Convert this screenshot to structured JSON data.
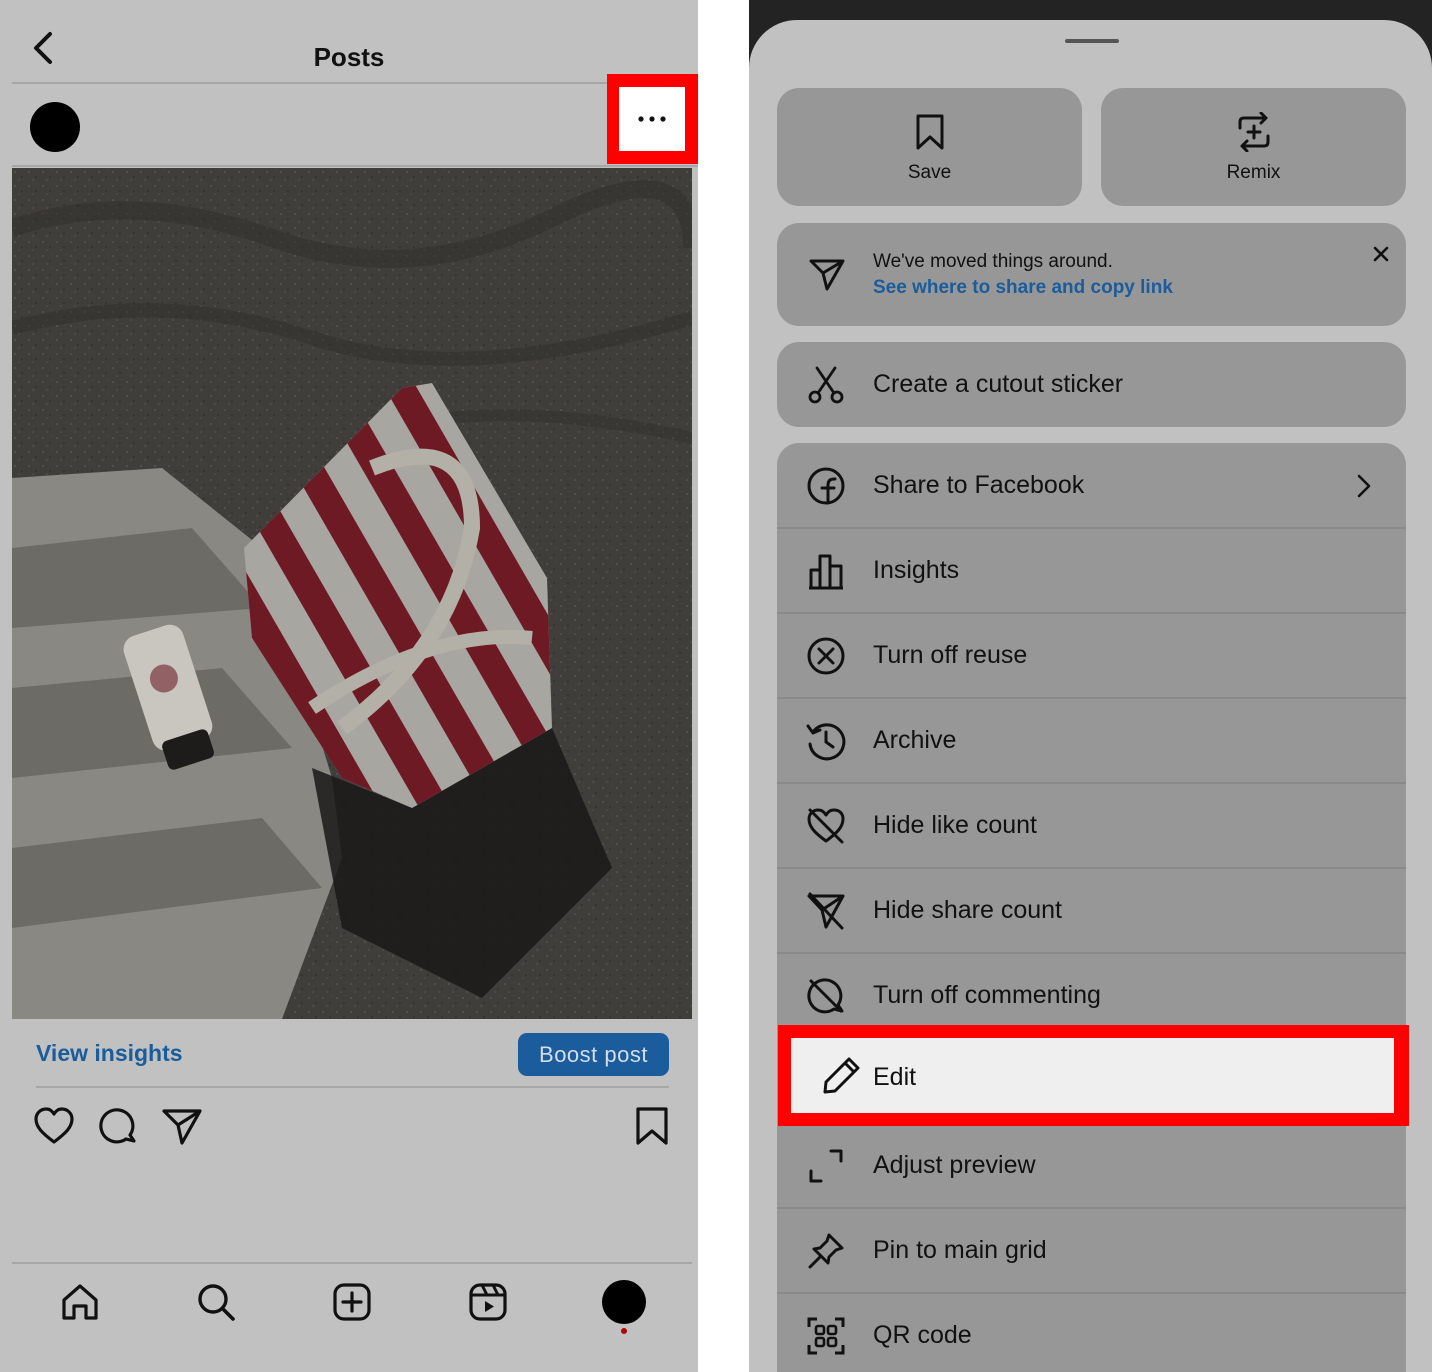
{
  "left": {
    "header": {
      "title": "Posts"
    },
    "post": {
      "view_insights": "View insights",
      "boost_button": "Boost post"
    }
  },
  "sheet": {
    "top_buttons": [
      {
        "label": "Save",
        "icon": "bookmark-icon"
      },
      {
        "label": "Remix",
        "icon": "remix-icon"
      }
    ],
    "notice": {
      "text": "We've moved things around.",
      "link": "See where to share and copy link",
      "icon": "send-icon"
    },
    "cutout": {
      "label": "Create a cutout sticker",
      "icon": "scissors-icon"
    },
    "menu": [
      {
        "label": "Share to Facebook",
        "icon": "facebook-icon"
      },
      {
        "label": "Insights",
        "icon": "bar-chart-icon"
      },
      {
        "label": "Turn off reuse",
        "icon": "x-circle-icon"
      },
      {
        "label": "Archive",
        "icon": "history-icon"
      },
      {
        "label": "Hide like count",
        "icon": "heart-off-icon"
      },
      {
        "label": "Hide share count",
        "icon": "send-off-icon"
      },
      {
        "label": "Turn off commenting",
        "icon": "comment-off-icon"
      },
      {
        "label": "Edit",
        "icon": "pencil-icon"
      },
      {
        "label": "Adjust preview",
        "icon": "expand-icon"
      },
      {
        "label": "Pin to main grid",
        "icon": "pin-icon"
      },
      {
        "label": "QR code",
        "icon": "qr-code-icon"
      }
    ]
  },
  "colors": {
    "dimmed_bg": "#c1c1c1",
    "card_bg": "#979797",
    "link_blue": "#1a5c9c",
    "highlight_red": "#ff0000"
  }
}
